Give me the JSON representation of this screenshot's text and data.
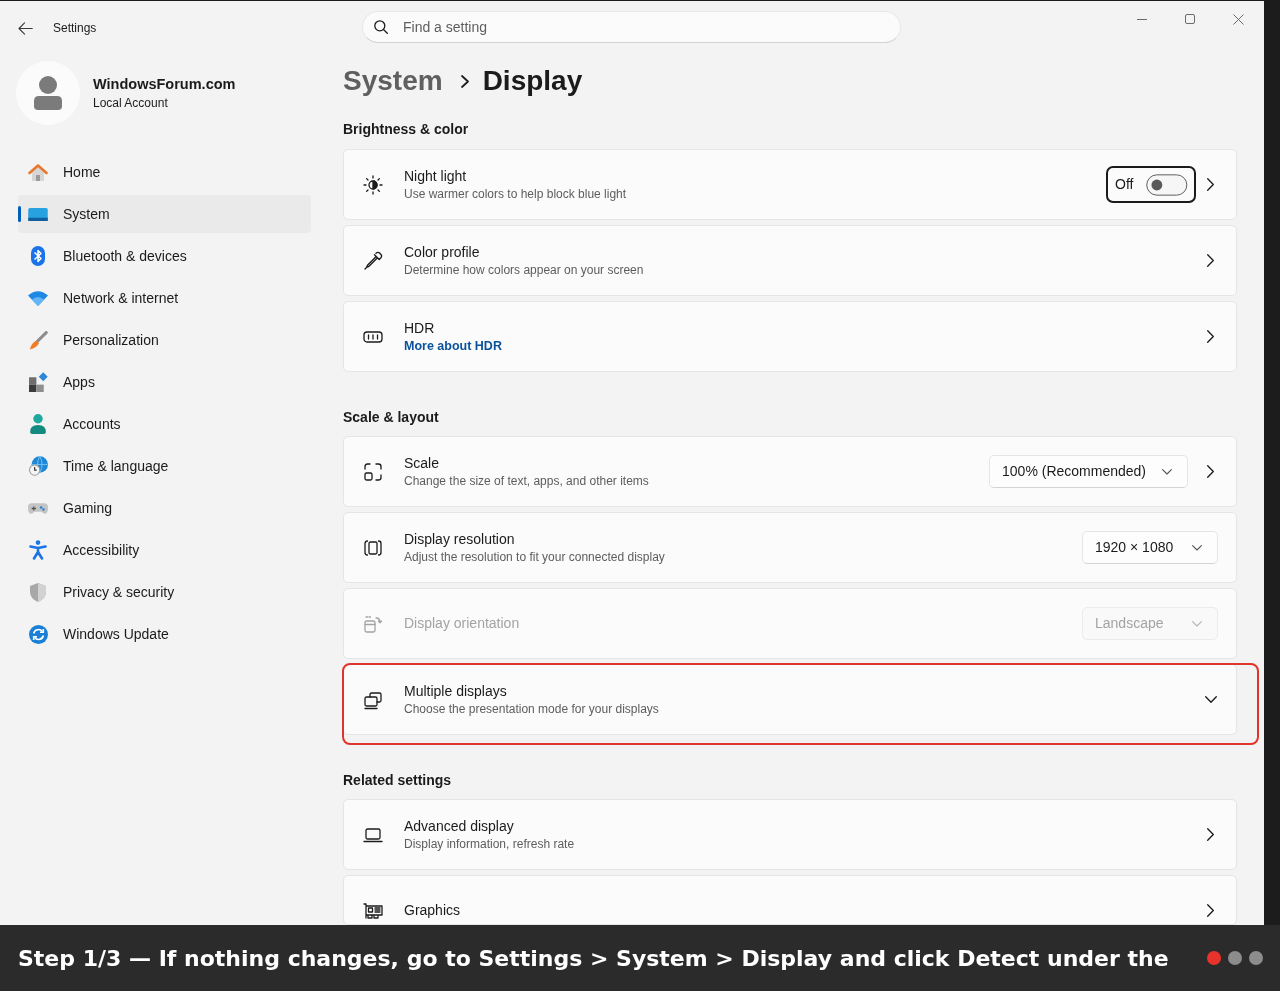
{
  "window": {
    "title": "Settings"
  },
  "search": {
    "placeholder": "Find a setting"
  },
  "account": {
    "name": "WindowsForum.com",
    "type": "Local Account"
  },
  "sidebar": {
    "items": [
      {
        "label": "Home",
        "selected": false
      },
      {
        "label": "System",
        "selected": true
      },
      {
        "label": "Bluetooth & devices",
        "selected": false
      },
      {
        "label": "Network & internet",
        "selected": false
      },
      {
        "label": "Personalization",
        "selected": false
      },
      {
        "label": "Apps",
        "selected": false
      },
      {
        "label": "Accounts",
        "selected": false
      },
      {
        "label": "Time & language",
        "selected": false
      },
      {
        "label": "Gaming",
        "selected": false
      },
      {
        "label": "Accessibility",
        "selected": false
      },
      {
        "label": "Privacy & security",
        "selected": false
      },
      {
        "label": "Windows Update",
        "selected": false
      }
    ]
  },
  "breadcrumb": {
    "parent": "System",
    "current": "Display"
  },
  "sections": [
    {
      "heading": "Brightness & color",
      "cards": [
        {
          "kind": "link",
          "title": "Night light",
          "description": "Use warmer colors to help block blue light",
          "control": {
            "kind": "toggle",
            "label": "Off",
            "on": false,
            "focused": true
          },
          "disabled": false,
          "highlighted": false
        },
        {
          "kind": "link",
          "title": "Color profile",
          "description": "Determine how colors appear on your screen",
          "disabled": false,
          "highlighted": false
        },
        {
          "kind": "link",
          "title": "HDR",
          "link": "More about HDR",
          "disabled": false,
          "highlighted": false
        }
      ]
    },
    {
      "heading": "Scale & layout",
      "cards": [
        {
          "kind": "link",
          "title": "Scale",
          "description": "Change the size of text, apps, and other items",
          "control": {
            "kind": "dropdown",
            "value": "100% (Recommended)"
          },
          "disabled": false,
          "highlighted": false
        },
        {
          "kind": "plain",
          "title": "Display resolution",
          "description": "Adjust the resolution to fit your connected display",
          "control": {
            "kind": "dropdown",
            "value": "1920 × 1080"
          },
          "disabled": false,
          "highlighted": false
        },
        {
          "kind": "plain",
          "title": "Display orientation",
          "control": {
            "kind": "dropdown",
            "value": "Landscape"
          },
          "disabled": true,
          "highlighted": false
        },
        {
          "kind": "expander",
          "title": "Multiple displays",
          "description": "Choose the presentation mode for your displays",
          "expanded": false,
          "disabled": false,
          "highlighted": true
        }
      ]
    },
    {
      "heading": "Related settings",
      "cards": [
        {
          "kind": "link",
          "title": "Advanced display",
          "description": "Display information, refresh rate",
          "disabled": false,
          "highlighted": false
        },
        {
          "kind": "link",
          "title": "Graphics",
          "disabled": false,
          "highlighted": false
        }
      ]
    }
  ],
  "caption": {
    "text": "Step 1/3 — If nothing changes, go to Settings > System > Display and click Detect under the",
    "steps": [
      {
        "selected": true
      },
      {
        "selected": false
      },
      {
        "selected": false
      }
    ]
  }
}
